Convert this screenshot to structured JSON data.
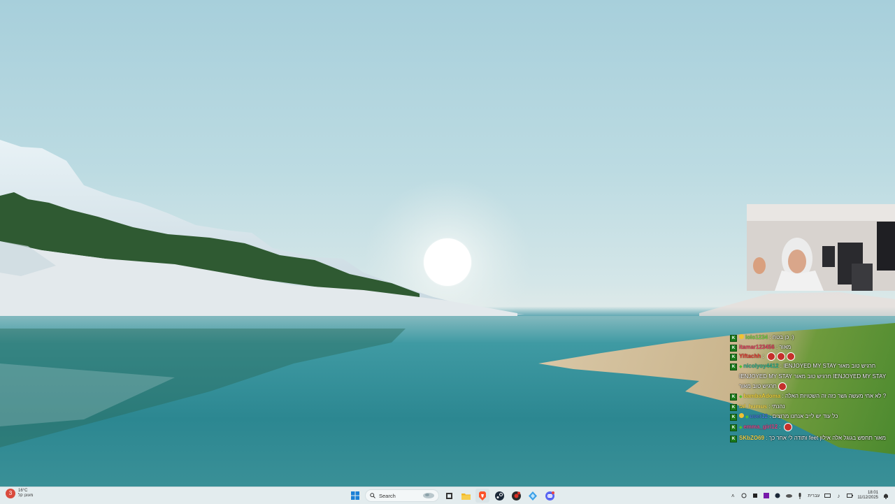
{
  "taskbar": {
    "weather": {
      "temp": "16°C",
      "condition": "מעונן קל",
      "alert_count": "3"
    },
    "search_label": "Search",
    "pinned_icons": [
      "windows-start-icon",
      "search-icon",
      "task-view-icon",
      "file-explorer-icon",
      "brave-browser-icon",
      "steam-icon",
      "chrome-icon",
      "edge-icon",
      "discord-icon"
    ],
    "language": "עברית",
    "time": "18:01",
    "date": "11/12/2025"
  },
  "chat": {
    "messages": [
      {
        "user": "lolo1234",
        "user_color": "#7bd44a",
        "text": "כן בטח :)",
        "sub": true
      },
      {
        "user": "itamar123456",
        "user_color": "#e3415e",
        "text": "מאור"
      },
      {
        "user": "Yiftachh",
        "user_color": "#e8392f",
        "text": "",
        "emotes": 3
      },
      {
        "user": "nicolyoy4412",
        "user_color": "#2fb38d",
        "text": "IENJOYED MY STAY  חרגיש טוב מאור  IENJOYED MY STAY  חרגיש טוב מאור  IENJOYED MY STAY  חרגיש טוב מאור",
        "emotes": 1,
        "plus": true
      },
      {
        "user": "bambaAdoma",
        "user_color": "#f0d23a",
        "text": "לא אחי מעשה גשר כזה זה השטויות האלה ?",
        "plus": true
      },
      {
        "user": "tal_humus",
        "user_color": "#f3d64b",
        "text": "נהנתי"
      },
      {
        "user": "user12",
        "user_color": "#4a7bd8",
        "text": "כל עוד יש לייב אנחנו מרוצים",
        "sub": true,
        "plus": true
      },
      {
        "user": "emma_girl12",
        "user_color": "#e34a8d",
        "text": "",
        "emotes": 1,
        "plus": true
      },
      {
        "user": "SKbZO69",
        "user_color": "#f2d34a",
        "text": "ותודה לי אחר כך feet מאור תחפש בגוגל אלה אילון"
      }
    ]
  }
}
